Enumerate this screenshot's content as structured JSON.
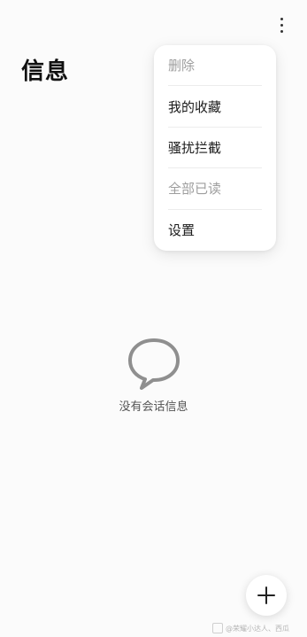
{
  "header": {
    "title": "信息",
    "more_icon": "more-vertical-icon"
  },
  "menu": {
    "items": [
      {
        "label": "删除",
        "enabled": false
      },
      {
        "label": "我的收藏",
        "enabled": true
      },
      {
        "label": "骚扰拦截",
        "enabled": true
      },
      {
        "label": "全部已读",
        "enabled": false
      },
      {
        "label": "设置",
        "enabled": true
      }
    ]
  },
  "empty_state": {
    "icon": "chat-bubble-icon",
    "text": "没有会话信息"
  },
  "fab": {
    "icon": "plus-icon"
  },
  "watermark": {
    "text": "@荣耀小达人、西瓜"
  },
  "colors": {
    "background": "#fbfbfb",
    "menu_background": "#ffffff",
    "text_primary": "#1b1b1b",
    "text_disabled": "#9e9e9e",
    "icon_gray": "#8f8f8f"
  }
}
